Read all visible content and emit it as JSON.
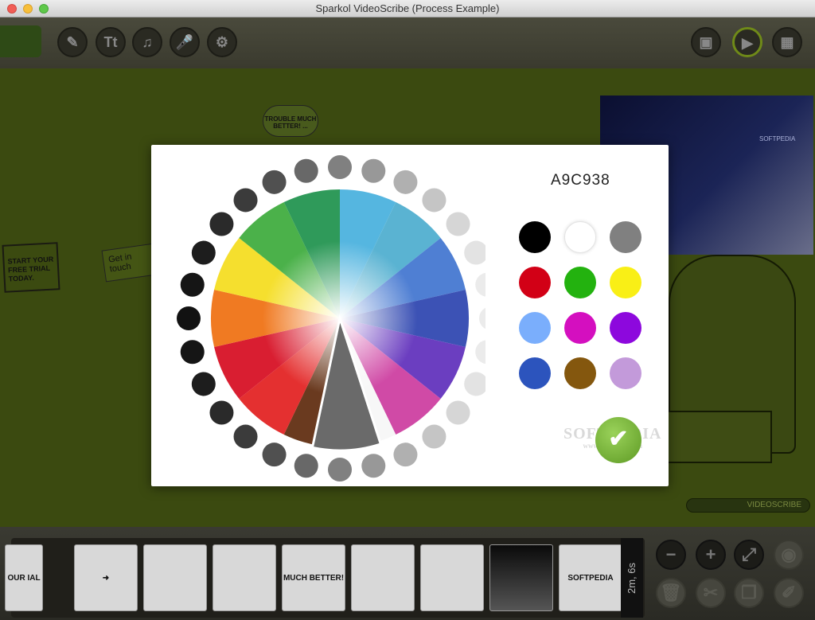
{
  "window": {
    "title": "Sparkol VideoScribe (Process Example)"
  },
  "toolbar": {
    "left_buttons": [
      {
        "id": "draw",
        "label": "✎",
        "icon": "pencil-icon"
      },
      {
        "id": "text",
        "label": "Tt",
        "icon": "text-icon"
      },
      {
        "id": "music",
        "label": "♫",
        "icon": "music-note-icon"
      },
      {
        "id": "voice",
        "label": "🎤",
        "icon": "microphone-icon"
      },
      {
        "id": "settings",
        "label": "⚙",
        "icon": "gear-icon"
      }
    ],
    "right_buttons": [
      {
        "id": "image",
        "label": "▣",
        "icon": "image-icon"
      },
      {
        "id": "play",
        "label": "▶",
        "icon": "play-icon"
      },
      {
        "id": "export",
        "label": "▦",
        "icon": "film-icon"
      }
    ]
  },
  "canvas": {
    "laptop_text": "START YOUR FREE TRIAL TODAY.",
    "card_text": "Get in touch",
    "cloud_text": "TROUBLE MUCH BETTER! ...",
    "pen_text": "VIDEOSCRIBE",
    "photo_text": "SOFTPEDIA"
  },
  "color_picker": {
    "hex_value": "A9C938",
    "wheel_colors": [
      "#55b6e0",
      "#5ab3d2",
      "#4f7fd3",
      "#3c52b5",
      "#6b3ec0",
      "#d04aa6",
      "#f7f7f7",
      "#6a3a1f",
      "#e43030",
      "#d91e31",
      "#f07a22",
      "#f5df2e",
      "#4bb14a",
      "#2f9a5a"
    ],
    "swatches": [
      {
        "name": "black",
        "color": "#000000"
      },
      {
        "name": "white",
        "color": "#ffffff"
      },
      {
        "name": "gray",
        "color": "#808080"
      },
      {
        "name": "red",
        "color": "#d20016"
      },
      {
        "name": "green",
        "color": "#23b20f"
      },
      {
        "name": "yellow",
        "color": "#f9ef16"
      },
      {
        "name": "light-blue",
        "color": "#7aaefc"
      },
      {
        "name": "magenta",
        "color": "#d40fbf"
      },
      {
        "name": "purple",
        "color": "#8d08dd"
      },
      {
        "name": "blue",
        "color": "#2c54bd"
      },
      {
        "name": "brown",
        "color": "#84570e"
      },
      {
        "name": "lavender",
        "color": "#c39ada"
      }
    ],
    "confirm_label": "✔",
    "watermark": "SOFTPEDIA",
    "watermark_url": "www.softpedia.com"
  },
  "timeline": {
    "prev_label": "‹",
    "thumbnails": [
      {
        "label": "OUR IAL Y."
      },
      {
        "label": "➜"
      },
      {
        "label": ""
      },
      {
        "label": ""
      },
      {
        "label": "MUCH BETTER!"
      },
      {
        "label": ""
      },
      {
        "label": ""
      },
      {
        "label": ""
      },
      {
        "label": "SOFTPEDIA TEST"
      }
    ],
    "duration": "2m, 6s"
  },
  "controls": [
    {
      "id": "zoom-out",
      "label": "−",
      "icon": "minus-icon"
    },
    {
      "id": "zoom-in",
      "label": "+",
      "icon": "plus-icon"
    },
    {
      "id": "zoom-fit",
      "label": "⤢",
      "icon": "zoom-icon"
    },
    {
      "id": "camera",
      "label": "◉",
      "icon": "camera-icon"
    },
    {
      "id": "delete",
      "label": "🗑",
      "icon": "trash-icon"
    },
    {
      "id": "cut",
      "label": "✂",
      "icon": "scissors-icon"
    },
    {
      "id": "copy",
      "label": "❐",
      "icon": "copy-icon"
    },
    {
      "id": "paint",
      "label": "✐",
      "icon": "brush-icon"
    }
  ]
}
